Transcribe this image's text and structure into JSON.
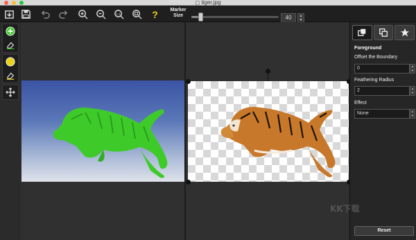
{
  "window": {
    "title": "tiger.jpg"
  },
  "toolbar": {
    "marker_label": "Marker Size",
    "marker_value": "40",
    "marker_level": 0.1,
    "icons": [
      "open-icon",
      "save-icon",
      "undo-icon",
      "redo-icon",
      "zoom-in-icon",
      "zoom-out-icon",
      "zoom-actual-icon",
      "zoom-fit-icon",
      "help-icon"
    ]
  },
  "left_tools": {
    "icons": [
      "add-foreground-icon",
      "eraser-icon",
      "mark-background-icon",
      "eraser-icon",
      "move-icon"
    ]
  },
  "panel": {
    "tabs": [
      "layers-icon",
      "duplicate-icon",
      "star-icon"
    ],
    "heading": "Foreground",
    "offset_label": "Offset the Boundary",
    "offset_value": "0",
    "feather_label": "Feathering Radius",
    "feather_value": "2",
    "effect_label": "Effect",
    "effect_value": "None",
    "reset_label": "Reset"
  },
  "watermark": "KK下载",
  "colors": {
    "toolbar_bg": "#1f1f1f",
    "accent_green": "#3ecb2a",
    "accent_yellow": "#e8d21a",
    "sky_top": "#3b54a4"
  }
}
